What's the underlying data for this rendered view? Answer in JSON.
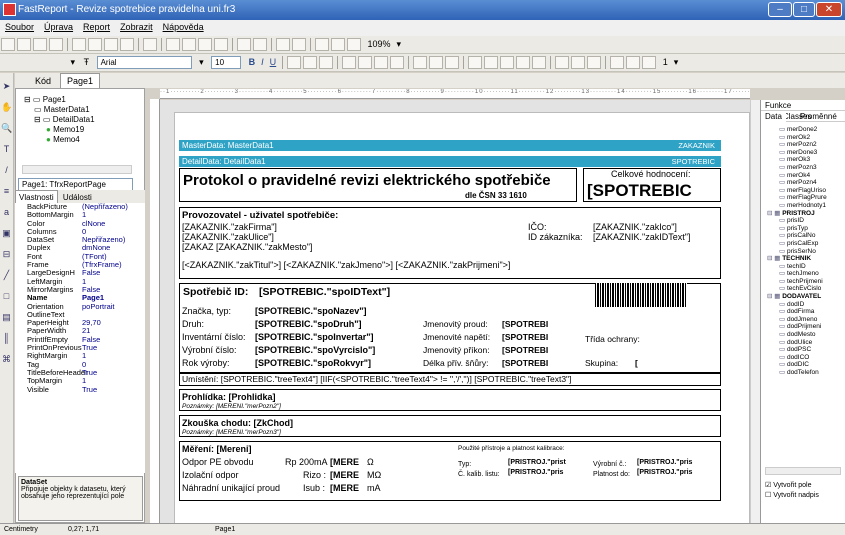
{
  "window": {
    "title": "FastReport - Revize spotrebice pravidelna uni.fr3"
  },
  "menu": [
    "Soubor",
    "Úprava",
    "Report",
    "Zobrazit",
    "Nápověda"
  ],
  "toolbar": {
    "zoom": "109%",
    "font": "Arial",
    "size": "10",
    "line_width": "1"
  },
  "tabs": {
    "code": "Kód",
    "page": "Page1"
  },
  "tree": [
    "Page1",
    "MasterData1",
    "DetailData1",
    "Memo19",
    "Memo4"
  ],
  "object_combo": "Page1: TfrxReportPage",
  "prop_tabs": [
    "Vlastnosti",
    "Události"
  ],
  "props": [
    [
      "BackPicture",
      "(Nepřiřazeno)"
    ],
    [
      "BottomMargin",
      "1"
    ],
    [
      "Color",
      "clNone"
    ],
    [
      "Columns",
      "0"
    ],
    [
      "DataSet",
      "Nepřiřazeno)"
    ],
    [
      "Duplex",
      "dmNone"
    ],
    [
      "Font",
      "(TFont)"
    ],
    [
      "Frame",
      "(TfrxFrame)"
    ],
    [
      "LargeDesignH",
      "False"
    ],
    [
      "LeftMargin",
      "1"
    ],
    [
      "MirrorMargins",
      "False"
    ],
    [
      "Name",
      "Page1"
    ],
    [
      "Orientation",
      "poPortrait"
    ],
    [
      "OutlineText",
      ""
    ],
    [
      "PaperHeight",
      "29,70"
    ],
    [
      "PaperWidth",
      "21"
    ],
    [
      "PrintIfEmpty",
      "False"
    ],
    [
      "PrintOnPrevious",
      "True"
    ],
    [
      "RightMargin",
      "1"
    ],
    [
      "Tag",
      "0"
    ],
    [
      "TitleBeforeHeader",
      "True"
    ],
    [
      "TopMargin",
      "1"
    ],
    [
      "Visible",
      "True"
    ]
  ],
  "help": {
    "title": "DataSet",
    "text": "Připojuje objekty k datasetu, který obsahuje jeho reprezentující pole"
  },
  "report": {
    "master_band": "MasterData: MasterData1",
    "master_right": "ZAKAZNIK",
    "detail_band": "DetailData: DetailData1",
    "detail_right": "SPOTREBIC",
    "title": "Protokol o pravidelné revizi elektrického spotřebiče",
    "subtitle": "dle ČSN 33 1610",
    "overall": "Celkové hodnocení:",
    "overall_val": "[SPOTREBIC",
    "operator": "Provozovatel - uživatel spotřebiče:",
    "firma": "[ZAKAZNIK.\"zakFirma\"]",
    "ulice": "[ZAKAZNIK.\"zakUlice\"]",
    "mesto": "[ZAKAZ  [ZAKAZNIK.\"zakMesto\"]",
    "ico_l": "IČO:",
    "ico_v": "[ZAKAZNIK.\"zakIco\"]",
    "idz_l": "ID zákazníka:",
    "idz_v": "[ZAKAZNIK.\"zakIDText\"]",
    "person": "[<ZAKAZNIK.\"zakTitul\">] [<ZAKAZNIK.\"zakJmeno\">] [<ZAKAZNIK.\"zakPrijmeni\">]",
    "spotr_id": "Spotřebič ID:",
    "spotr_id_v": "[SPOTREBIC.\"spoIDText\"]",
    "rows": [
      [
        "Značka, typ:",
        "[SPOTREBIC.\"spoNazev\"]"
      ],
      [
        "Druh:",
        "[SPOTREBIC.\"spoDruh\"]"
      ],
      [
        "Inventární číslo:",
        "[SPOTREBIC.\"spoInvertar\"]"
      ],
      [
        "Výrobní číslo:",
        "[SPOTREBIC.\"spoVyrcislo\"]"
      ],
      [
        "Rok výroby:",
        "[SPOTREBIC.\"spoRokvyr\"]"
      ]
    ],
    "rrows": [
      [
        "Jmenovitý proud:",
        "[SPOTREBI"
      ],
      [
        "Jmenovité napětí:",
        "[SPOTREBI"
      ],
      [
        "Jmenovitý příkon:",
        "[SPOTREBI"
      ],
      [
        "Délka přív. šňůry:",
        "[SPOTREBI"
      ]
    ],
    "trida": "Třída ochrany:",
    "skupina": "Skupina:",
    "skupina_v": "[",
    "umisteni": "Umístění: [SPOTREBIC.\"treeText4\"] [IIF(<SPOTREBIC.\"treeText4\"> != '','/','')] [SPOTREBIC.\"treeText3\"]",
    "prohlidka": "Prohlídka: [Prohlidka]",
    "pozn1": "Poznámky: [MERENI.\"merPozn2\"]",
    "zkouska": "Zkouška chodu: [ZkChod]",
    "pozn2": "Poznámky: [MERENI.\"merPozn3\"]",
    "mereni": "Měření: [Mereni]",
    "mrows": [
      [
        "Odpor PE obvodu",
        "Rp 200mA",
        "[MERE",
        "Ω"
      ],
      [
        "Izolační odpor",
        "Rizo :",
        "[MERE",
        "MΩ"
      ],
      [
        "Náhradní unikající proud",
        "Isub :",
        "[MERE",
        "mA"
      ]
    ],
    "kal": "Použité přístroje a platnost kalibrace:",
    "kal_rows": [
      [
        "Typ:",
        "[PRISTROJ.\"prist",
        "Výrobní č.:",
        "[PRISTROJ.\"pris"
      ],
      [
        "Č. kalib. listu:",
        "[PRISTROJ.\"pris",
        "Platnost do:",
        "[PRISTROJ.\"pris"
      ]
    ]
  },
  "right_tabs": [
    "Funkce",
    "Classes",
    "Data",
    "Proměnné"
  ],
  "right_tree": [
    "merDone2",
    "merOk2",
    "merPozn2",
    "merDone3",
    "merOk3",
    "merPozn3",
    "merOk4",
    "merPozn4",
    "merFlagUriso",
    "merFlagPrure",
    "merHodnoty1",
    "PRISTROJ",
    "prisID",
    "prisTyp",
    "prisCalNo",
    "prisCalExp",
    "prisSerNo",
    "TECHNIK",
    "techID",
    "techJmeno",
    "techPrijmeni",
    "techEvCislo",
    "DODAVATEL",
    "dodID",
    "dodFirma",
    "dodJmeno",
    "dodPrijmeni",
    "dodMesto",
    "dodUlice",
    "dodPSC",
    "dodICO",
    "dodDIC",
    "dodTelefon"
  ],
  "right_check": [
    "Vytvořit pole",
    "Vytvořit nadpis"
  ],
  "status": {
    "units": "Centimetry",
    "coords": "0,27; 1,71",
    "page": "Page1"
  }
}
